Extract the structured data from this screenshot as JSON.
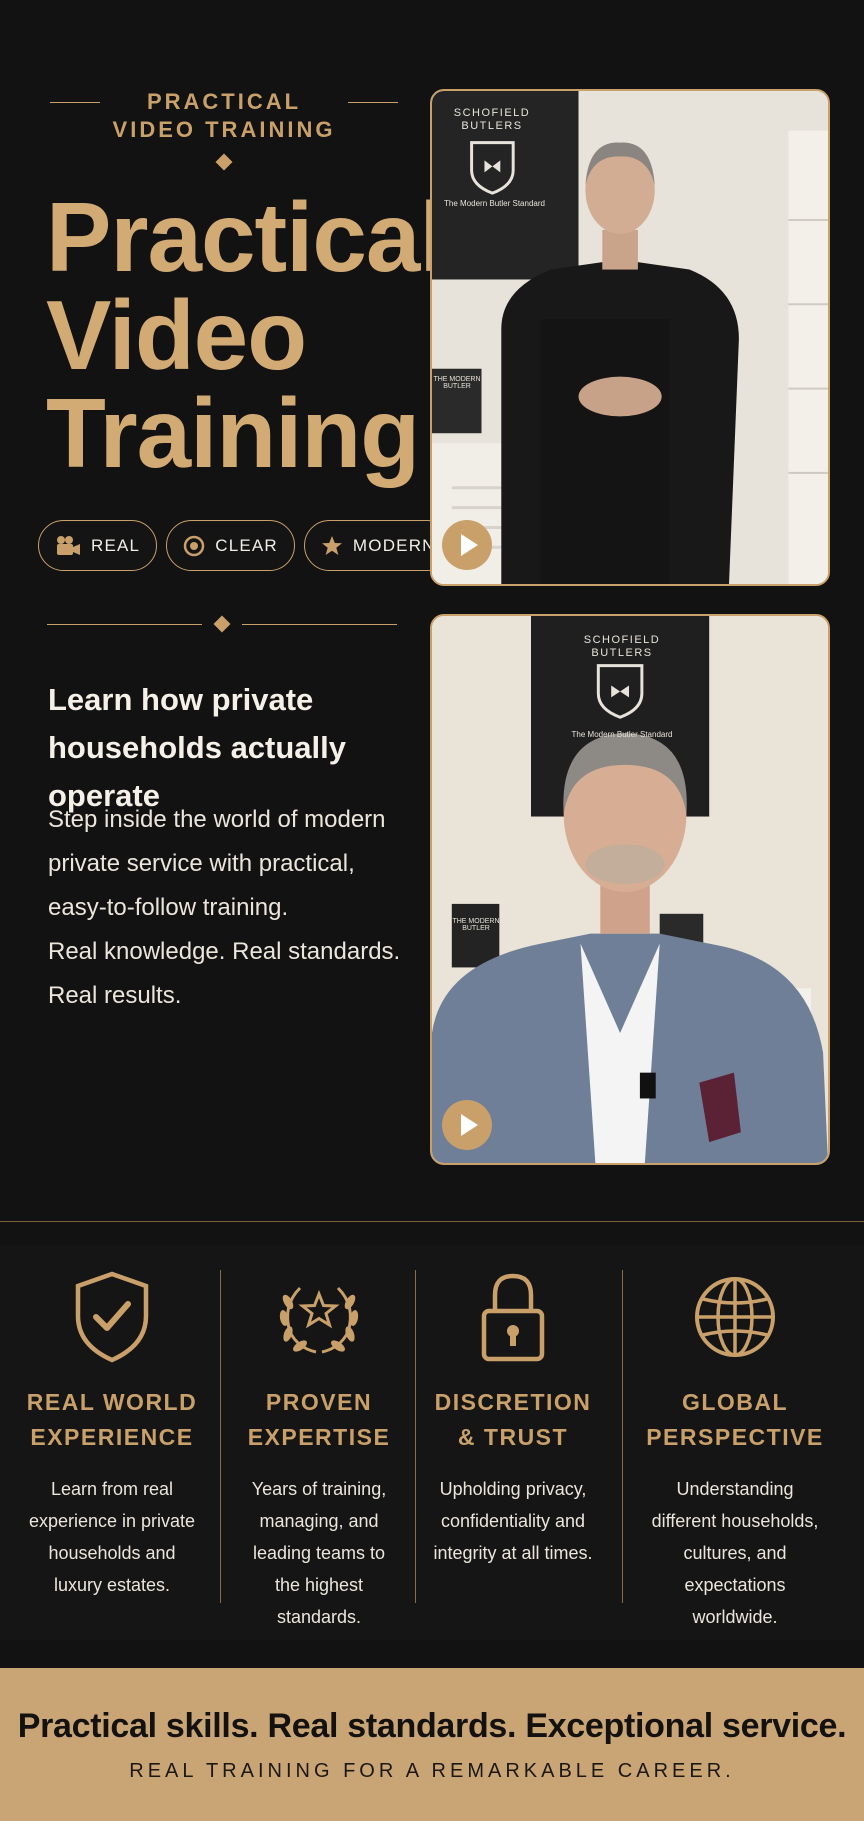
{
  "hero": {
    "eyebrow": "PRACTICAL VIDEO TRAINING",
    "title_lines": [
      "Practical",
      "Video",
      "Training"
    ],
    "pills": [
      {
        "icon": "video-camera-icon",
        "label": "REAL"
      },
      {
        "icon": "target-icon",
        "label": "CLEAR"
      },
      {
        "icon": "star-icon",
        "label": "MODERN"
      }
    ],
    "subhead": "Learn how private households actually operate",
    "body_lines": [
      "Step inside the world of modern",
      "private service with practical,",
      "easy-to-follow training.",
      "Real knowledge. Real standards.",
      "Real results."
    ]
  },
  "videos": [
    {
      "poster_brand": "SCHOFIELD BUTLERS",
      "poster_tagline": "The Modern Butler Standard",
      "book_title": "THE MODERN BUTLER",
      "play_icon": "play-icon"
    },
    {
      "poster_brand": "SCHOFIELD BUTLERS",
      "poster_tagline": "The Modern Butler Standard",
      "book_title": "THE MODERN BUTLER",
      "play_icon": "play-icon"
    }
  ],
  "features": [
    {
      "icon": "shield-check-icon",
      "title_lines": [
        "REAL WORLD",
        "EXPERIENCE"
      ],
      "desc_lines": [
        "Learn from real",
        "experience in private",
        "households and",
        "luxury estates."
      ]
    },
    {
      "icon": "laurel-star-icon",
      "title_lines": [
        "PROVEN",
        "EXPERTISE"
      ],
      "desc_lines": [
        "Years of training,",
        "managing, and",
        "leading teams to",
        "the highest",
        "standards."
      ]
    },
    {
      "icon": "padlock-icon",
      "title_lines": [
        "DISCRETION",
        "& TRUST"
      ],
      "desc_lines": [
        "Upholding privacy,",
        "confidentiality and",
        "integrity at all times."
      ]
    },
    {
      "icon": "globe-icon",
      "title_lines": [
        "GLOBAL",
        "PERSPECTIVE"
      ],
      "desc_lines": [
        "Understanding",
        "different households,",
        "cultures, and",
        "expectations",
        "worldwide."
      ]
    }
  ],
  "footer": {
    "tagline": "Practical skills. Real standards. Exceptional service.",
    "subtagline": "REAL TRAINING FOR A REMARKABLE CAREER."
  },
  "colors": {
    "gold": "#c9a06a",
    "title_gold": "#d2aa74",
    "background": "#121212",
    "bar": "#c9a575"
  }
}
